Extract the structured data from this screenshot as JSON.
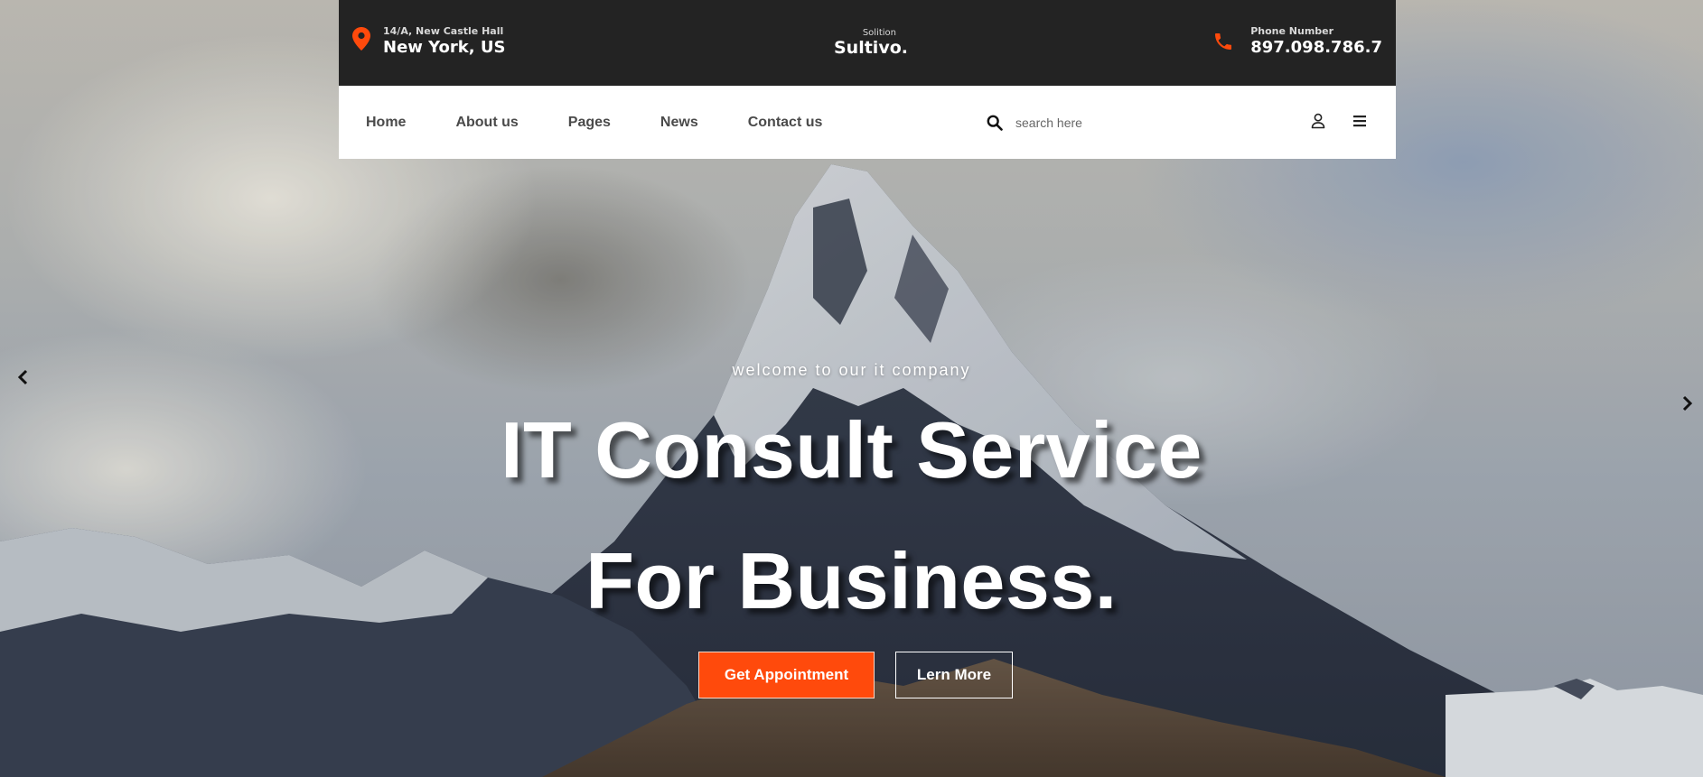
{
  "topbar": {
    "address_small": "14/A, New Castle Hall",
    "address_big": "New York, US",
    "logo_small": "Solition",
    "logo_brand": "Sultivo.",
    "phone_small": "Phone Number",
    "phone_big": "897.098.786.7",
    "accent_color": "#ff4a0c",
    "icons": [
      "map-pin-icon",
      "phone-icon"
    ]
  },
  "nav": {
    "links": [
      "Home",
      "About us",
      "Pages",
      "News",
      "Contact us"
    ],
    "search_placeholder": "search here",
    "icons": [
      "search-icon",
      "user-icon",
      "menu-icon"
    ]
  },
  "hero": {
    "eyebrow": "welcome to our it company",
    "headline_line1": "IT Consult Service",
    "headline_line2": "For Business.",
    "primary_button": "Get Appointment",
    "secondary_button": "Lern More",
    "slider_icons": [
      "chevron-left-icon",
      "chevron-right-icon"
    ]
  }
}
